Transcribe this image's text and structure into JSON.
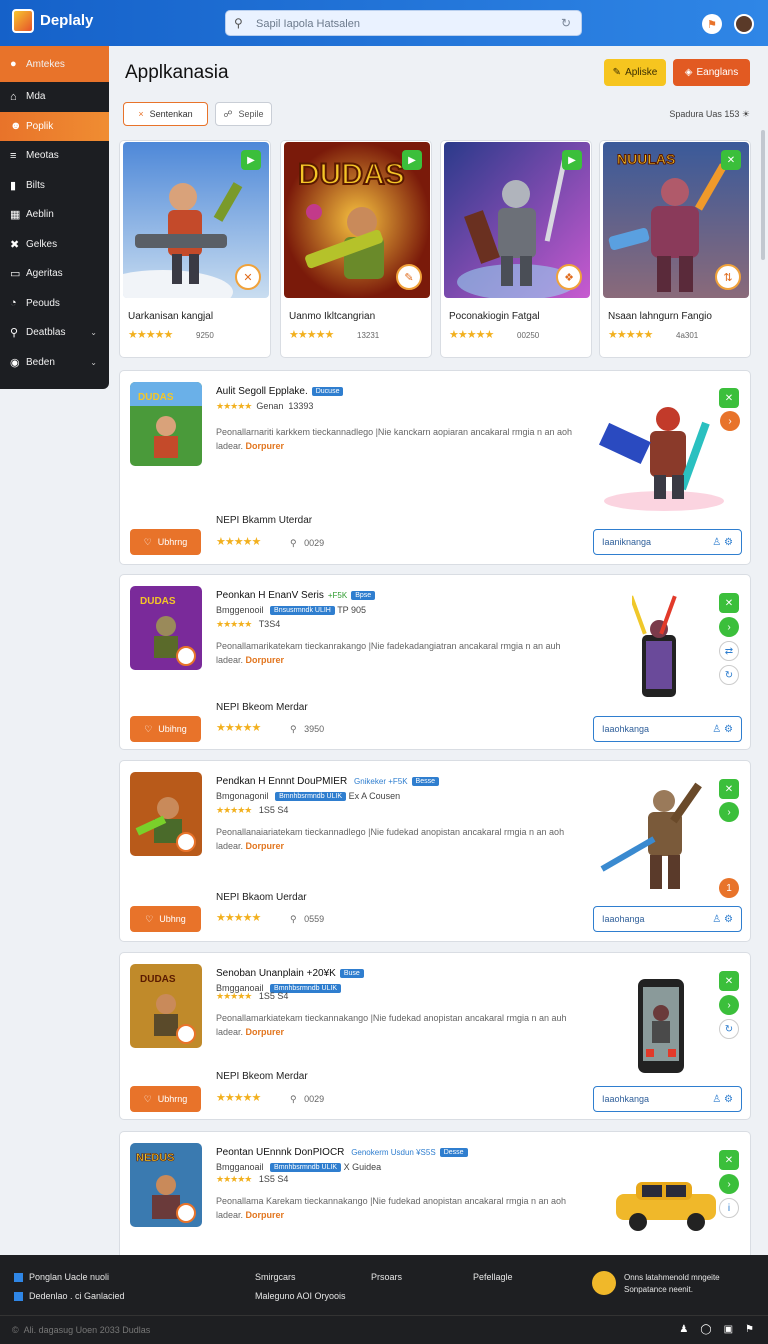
{
  "header": {
    "brand": "Deplaly",
    "brand_sub": "",
    "search_placeholder": "Sapil Iapola Hatsalen",
    "search_icon": "search-icon",
    "refresh_icon": "refresh-icon",
    "notify_icon": "notification-icon",
    "avatar_icon": "avatar"
  },
  "sidebar": {
    "items": [
      {
        "label": "Amtekes",
        "icon": "A"
      },
      {
        "label": "Mda",
        "icon": "A"
      },
      {
        "label": "Poplik",
        "icon": "☻",
        "active": true
      },
      {
        "label": "Meotas",
        "icon": "≡"
      },
      {
        "label": "Bilts",
        "icon": "▮"
      },
      {
        "label": "Aeblin",
        "icon": "H"
      },
      {
        "label": "Gelkes",
        "icon": "✕"
      },
      {
        "label": "Ageritas",
        "icon": "▭"
      },
      {
        "label": "Peouds",
        "icon": "◔"
      },
      {
        "label": "Deatblas",
        "icon": "⚲",
        "chevron": true
      },
      {
        "label": "Beden",
        "icon": "◉",
        "chevron": true
      }
    ]
  },
  "main": {
    "title": "Applkanasia",
    "btn_yellow": "Apliske",
    "btn_red": "Eanglans",
    "filter1": "Sentenkan",
    "filter2": "Sepile",
    "sort_label": "Spadura Uas 153",
    "featured": [
      {
        "title": "Uarkanisan kangjal",
        "count": "9250"
      },
      {
        "title": "Uanmo Ikltcangrian",
        "count": "13231"
      },
      {
        "title": "Poconakiogin Fatgal",
        "count": "00250"
      },
      {
        "title": "Nsaan lahngurn Fangio",
        "count": "4a301"
      }
    ],
    "list": [
      {
        "title": "Aulit Segoll Epplake.",
        "tag": "Ducuse",
        "sub": "Genan",
        "sub_count": "13393",
        "desc": "Peonallarnariti karkkem tieckannadlego |Nie kanckarn aopiaran ancakaral rmgia n an aoh ladear.",
        "more": "Dorpurer",
        "dev": "NEPI Bkamm Uterdar",
        "count": "0029",
        "wish": "Ubhrng",
        "install": "Iaaniknanga"
      },
      {
        "title": "Peonkan H EnanV Seris",
        "tag": "Bpse",
        "tag2": "+F5K",
        "sub": "Bmggenooil",
        "sub2": "Bnsusrmndk ULIH",
        "sub3": "TP 905",
        "sub_count": "T3S4",
        "desc": "Peonallamarikatekam tieckanrakango |Nie fadekadangiatran ancakaral rmgia n an auh ladear.",
        "more": "Dorpurer",
        "dev": "NEPI Bkeom Merdar",
        "count": "3950",
        "wish": "Ubihng",
        "install": "Iaaohkanga"
      },
      {
        "title": "Pendkan H Ennnt DouPMIER",
        "tag": "Besse",
        "tag2": "Gnikeker +F5K",
        "sub": "Bmgonagonil",
        "sub2": "Bmnhbsrmndb ULIK",
        "sub3": "Ex  A Cousen",
        "sub_count": "1S5 S4",
        "desc": "Peonallanaiariatekam tieckannadlego |Nie fudekad anopistan ancakaral rmgia n an aoh ladear.",
        "more": "Dorpurer",
        "dev": "NEPI Bkaom Uerdar",
        "count": "0559",
        "wish": "Ubhng",
        "install": "Iaaohanga"
      },
      {
        "title": "Senoban Unanplain +20¥K",
        "tag": "Buse",
        "tag2": "",
        "sub": "Bmgganoail",
        "sub2": "Bmnhbsrmndb ULIK",
        "sub3": "",
        "sub_count": "1S5 S4",
        "desc": "Peonallamarkiatekam tieckannakango |Nie fudekad anopistan ancakaral rmgia n an auh ladear.",
        "more": "Dorpurer",
        "dev": "NEPI Bkeom Merdar",
        "count": "0029",
        "wish": "Ubhrng",
        "install": "Iaaohkanga"
      },
      {
        "title": "Peontan UEnnnk DonPIOCR",
        "tag": "Desse",
        "tag2": "Genokerm Usdun ¥S5S",
        "sub": "Bmgganoail",
        "sub2": "Bmnhbsrmndb ULIK",
        "sub3": "X Guidea",
        "sub_count": "1S5 S4",
        "desc": "Peonallama Karekam tieckannakango |Nie fudekad anopistan ancakaral rmgia n an aoh ladear.",
        "more": "Dorpurer",
        "dev": "",
        "count": "",
        "wish": "",
        "install": ""
      }
    ]
  },
  "footer": {
    "col1a": "Ponglan Uacle nuoli",
    "col1b": "Dedenlao . ci  Ganlacied",
    "col2a": "Smirgcars",
    "col2b": "Maleguno AOI Oryoois",
    "col3": "Prsoars",
    "col4": "Pefellagle",
    "promo1": "Onns latahmenold mngeite",
    "promo2": "Sonpatance neenit.",
    "copy": "Ali. dagasug Uoen 2033 Dudlas"
  },
  "colors": {
    "accent": "#e8732a",
    "primary": "#1f73d6",
    "green": "#3bbf3b",
    "star": "#f2b01e"
  }
}
